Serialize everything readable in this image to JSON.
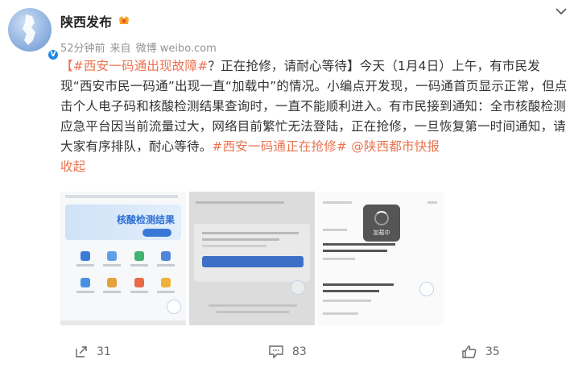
{
  "post": {
    "author": "陕西发布",
    "time": "52分钟前",
    "source_prefix": "来自",
    "source": "微博 weibo.com",
    "content": {
      "hashtag1": "【#西安一码通出现故障#",
      "text1": "？正在抢修，请耐心等待】今天（1月4日）上午，有市民发现“西安市民一码通”出现一直“加载中”的情况。小编点开发现，一码通首页显示正常，但点击个人电子码和核酸检测结果查询时，一直不能顺利进入。有市民接到通知：全市核酸检测应急平台因当前流量过大，网络目前繁忙无法登陆，正在抢修，一旦恢复第一时间通知，请大家有序排队，耐心等待。",
      "hashtag2": "#西安一码通正在抢修#",
      "mention": "@陕西都市快报",
      "collapse": "收起"
    },
    "images": [
      {
        "banner_text": "核酸检测结果"
      },
      {},
      {
        "loading_text": "加载中"
      }
    ],
    "actions": {
      "share_count": "31",
      "comment_count": "83",
      "like_count": "35"
    }
  },
  "icons": {
    "vip": "vip-badge-icon",
    "verified": "verified-badge-icon",
    "expand": "chevron-down-icon",
    "share": "share-icon",
    "comment": "comment-icon",
    "like": "thumbs-up-icon"
  },
  "colors": {
    "link": "#eb7350",
    "meta": "#939393",
    "verified": "#1e88e5"
  }
}
